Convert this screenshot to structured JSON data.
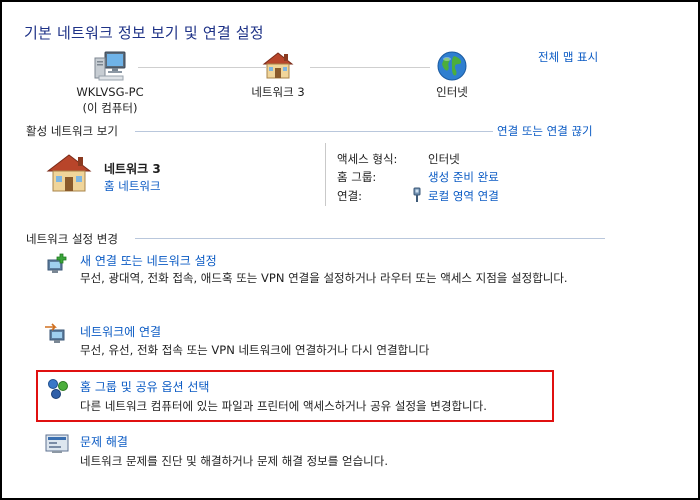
{
  "title": "기본 네트워크 정보 보기 및 연결 설정",
  "map": {
    "full_map_link": "전체 맵 표시",
    "nodes": [
      {
        "line1": "WKLVSG-PC",
        "line2": "(이 컴퓨터)"
      },
      {
        "line1": "네트워크  3",
        "line2": ""
      },
      {
        "line1": "인터넷",
        "line2": ""
      }
    ]
  },
  "active": {
    "section_title": "활성 네트워크 보기",
    "connect_disconnect": "연결 또는 연결 끊기",
    "network_name": "네트워크  3",
    "network_type": "홈 네트워크",
    "rows": [
      {
        "label": "액세스 형식:",
        "value": "인터넷",
        "is_link": false
      },
      {
        "label": "홈 그룹:",
        "value": "생성 준비 완료",
        "is_link": true
      },
      {
        "label": "연결:",
        "value": "로컬 영역 연결",
        "is_link": true
      }
    ]
  },
  "change": {
    "section_title": "네트워크 설정 변경",
    "tasks": [
      {
        "title": "새 연결 또는 네트워크 설정",
        "desc": "무선, 광대역, 전화 접속, 애드혹 또는 VPN 연결을 설정하거나 라우터 또는 액세스 지점을 설정합니다."
      },
      {
        "title": "네트워크에 연결",
        "desc": "무선, 유선, 전화 접속 또는 VPN 네트워크에 연결하거나 다시 연결합니다"
      },
      {
        "title": "홈 그룹 및 공유 옵션 선택",
        "desc": "다른 네트워크 컴퓨터에 있는 파일과 프린터에 액세스하거나 공유 설정을 변경합니다."
      },
      {
        "title": "문제 해결",
        "desc": "네트워크 문제를 진단 및 해결하거나 문제 해결 정보를 얻습니다."
      }
    ]
  },
  "colors": {
    "link": "#0b5bc4",
    "title": "#1e3287",
    "highlight": "#e01010"
  }
}
